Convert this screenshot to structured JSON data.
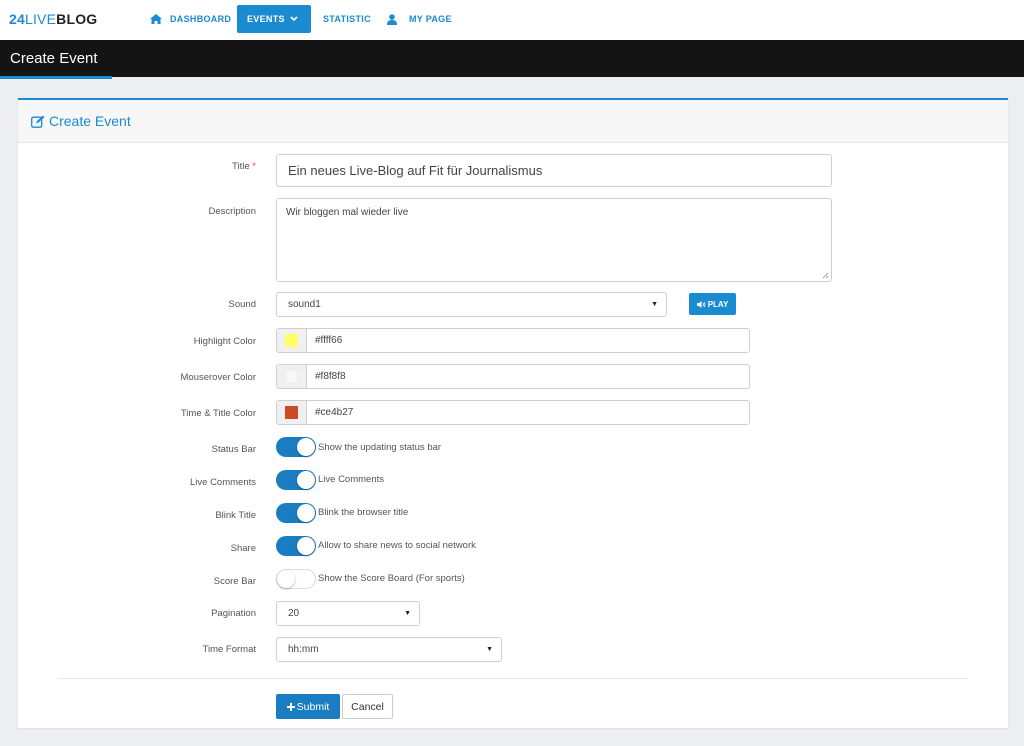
{
  "app": {
    "logo_number": "24",
    "logo_mid": "LIVE",
    "logo_end": "BLOG"
  },
  "nav": {
    "dashboard": "DASHBOARD",
    "events": "EVENTS",
    "statistic": "STATISTIC",
    "my_page": "MY PAGE"
  },
  "header": {
    "title": "Create Event"
  },
  "panel": {
    "title": "Create Event"
  },
  "form": {
    "title_label": "Title",
    "title_required": "*",
    "title_value": "Ein neues Live-Blog auf Fit für Journalismus",
    "description_label": "Description",
    "description_value": "Wir bloggen mal wieder live",
    "sound_label": "Sound",
    "sound_value": "sound1",
    "play_label": "PLAY",
    "highlight_label": "Highlight Color",
    "highlight_value": "#ffff66",
    "mouseover_label": "Mouserover Color",
    "mouseover_value": "#f8f8f8",
    "time_title_label": "Time & Title Color",
    "time_title_value": "#ce4b27",
    "status_bar_label": "Status Bar",
    "status_bar_text": "Show the updating status bar",
    "status_bar_on": true,
    "live_comments_label": "Live Comments",
    "live_comments_text": "Live Comments",
    "live_comments_on": true,
    "blink_title_label": "Blink Title",
    "blink_title_text": "Blink the browser title",
    "blink_title_on": true,
    "share_label": "Share",
    "share_text": "Allow to share news to social network",
    "share_on": true,
    "score_bar_label": "Score Bar",
    "score_bar_text": "Show the Score Board (For sports)",
    "score_bar_on": false,
    "pagination_label": "Pagination",
    "pagination_value": "20",
    "time_format_label": "Time Format",
    "time_format_value": "hh:mm",
    "submit_label": "Submit",
    "cancel_label": "Cancel"
  },
  "colors": {
    "accent": "#1a8bd1",
    "highlight": "#ffff66",
    "mouseover": "#f8f8f8",
    "time_title": "#ce4b27"
  }
}
